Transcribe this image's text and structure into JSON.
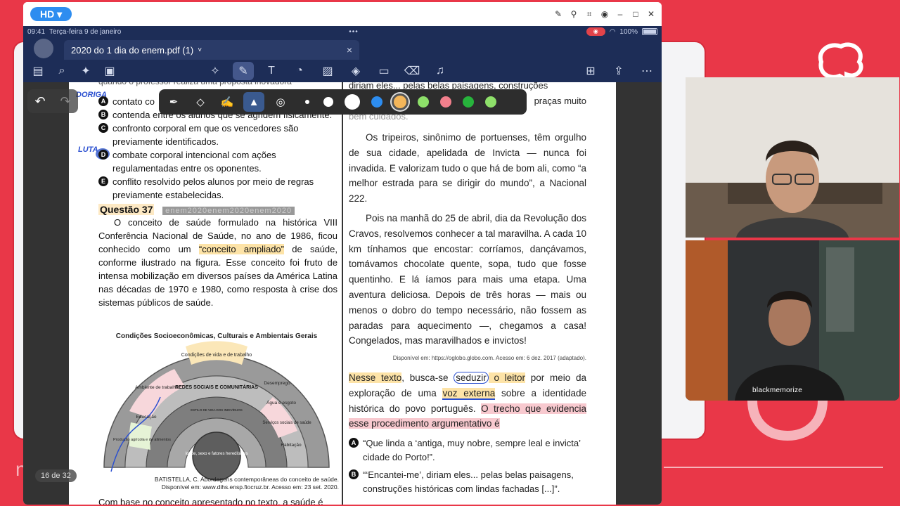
{
  "window": {
    "hd_label": "HD ▾",
    "status": {
      "time": "09:41",
      "date": "Terça-feira 9 de janeiro",
      "dots": "•••",
      "wifi_battery": "100%"
    },
    "tab": {
      "title": "2020 do 1 dia do enem.pdf (1)",
      "chevron": "˅",
      "close": "×"
    }
  },
  "toolbar": {
    "left_icons": [
      "sidebar-icon",
      "search-icon",
      "sparkle-icon",
      "document-icon"
    ],
    "center_icons": [
      "lasso-icon",
      "pen-icon",
      "textbox-icon",
      "shapes-icon",
      "image-icon",
      "elements-icon",
      "sticky-note-icon",
      "eraser-icon",
      "microphone-icon"
    ],
    "right_icons": [
      "add-page-icon",
      "share-icon",
      "more-icon"
    ]
  },
  "pen_bar": {
    "swatches": [
      "#ffffff",
      "#ffffff",
      "#2d8df0",
      "#f4b65a",
      "#8ee06a",
      "#f27f8c",
      "#27b43c",
      "#8ee06a"
    ]
  },
  "page_counter": "16 de 32",
  "left_page": {
    "header_fragment": "quando o professor realiza uma proposta inovadora",
    "annotation_1": "DORIGA",
    "annotation_2": "LUTA",
    "options": [
      {
        "letter": "A",
        "text": "contato co"
      },
      {
        "letter": "B",
        "text": "contenda entre os alunos que se agridem fisicamente."
      },
      {
        "letter": "C",
        "text": "confronto corporal em que os vencedores são previamente identificados."
      },
      {
        "letter": "D",
        "text": "combate corporal intencional com ações regulamentadas entre os oponentes."
      },
      {
        "letter": "E",
        "text": "conflito resolvido pelos alunos por meio de regras previamente estabelecidas."
      }
    ],
    "question_title": "Questão 37",
    "question_tag": "enem2020enem2020enem2020",
    "question_pre": "O conceito de saúde formulado na histórica VIII Conferência Nacional de Saúde, no ano de 1986, ficou conhecido como um ",
    "question_highlight": "“conceito ampliado”",
    "question_post": " de saúde, conforme ilustrado na figura. Esse conceito foi fruto de intensa mobilização em diversos países da América Latina nas décadas de 1970 e 1980, como resposta à crise dos sistemas públicos de saúde.",
    "diagram": {
      "outer_label": "Condições Socioeconômicas, Culturais e Ambientais Gerais",
      "middle_top": "Condições de vida e de trabalho",
      "segments": [
        "Ambiente de trabalho",
        "Educação",
        "Produção agrícola e de alimentos",
        "Desemprego",
        "Água e esgoto",
        "Serviços sociais de saúde",
        "Habitação"
      ],
      "inner_ring": "REDES SOCIAIS E COMUNITÁRIAS",
      "inner_small": "ESTILO DE VIDA DOS INDIVÍDUOS",
      "core": "Idade, sexo e fatores hereditários"
    },
    "caption_line1": "BATISTELLA, C. Abordagens contemporâneas do conceito de saúde.",
    "caption_line2": "Disponível em: www.dihs.ensp.fiocruz.br. Acesso em: 23 set. 2020.",
    "bottom_text": "Com base no conceito apresentado no texto, a saúde é"
  },
  "right_page": {
    "top_fragment_1": "diriam eles... pelas belas paisagens, construções",
    "top_fragment_2": "praças muito",
    "top_fragment_3": "bem cuidados.",
    "para1": "Os tripeiros, sinônimo de portuenses, têm orgulho de sua cidade, apelidada de Invicta — nunca foi invadida. E valorizam tudo o que há de bom ali, como “a melhor estrada para se dirigir do mundo”, a Nacional 222.",
    "para2": "Pois na manhã do 25 de abril, dia da Revolução dos Cravos, resolvemos conhecer a tal maravilha. A cada 10 km tínhamos que encostar: corríamos, dançávamos, tomávamos chocolate quente, sopa, tudo que fosse quentinho. E lá íamos para mais uma etapa. Uma aventura deliciosa. Depois de três horas — mais ou menos o dobro do tempo necessário, não fossem as paradas para aquecimento —, chegamos a casa! Congelados, mas maravilhados e invictos!",
    "source": "Disponível em: https://oglobo.globo.com. Acesso em: 6 dez. 2017 (adaptado).",
    "prompt_a": "Nesse texto",
    "prompt_b": ", busca-se ",
    "prompt_c": "seduzir",
    "prompt_d": " o leitor",
    "prompt_e": " por meio da exploração de uma ",
    "prompt_f": "voz externa",
    "prompt_g": " sobre a identidade histórica do povo português. ",
    "prompt_h": "O trecho que evidencia esse procedimento argumentativo é",
    "answers": [
      {
        "letter": "A",
        "text": "“Que linda a ‘antiga, muy nobre, sempre leal e invicta’ cidade do Porto!”."
      },
      {
        "letter": "B",
        "text": "“‘Encantei-me’, diriam eles... pelas belas paisagens, construções históricas com lindas fachadas [...]”."
      }
    ]
  },
  "webcam": {
    "bottom_label": "blackmemorize"
  },
  "colors": {
    "accent": "#e93748",
    "nav": "#1d2d57",
    "highlight_yellow": "#fde3a7",
    "highlight_pink": "#f8c9cf"
  }
}
